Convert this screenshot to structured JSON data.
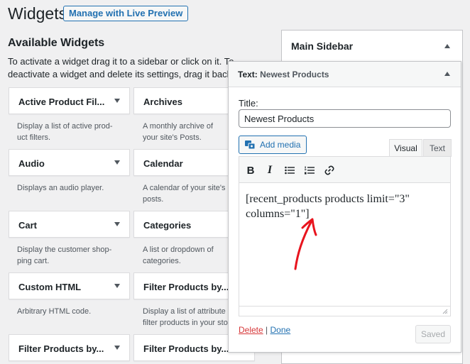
{
  "header": {
    "title": "Widgets",
    "preview_button": "Manage with Live Preview"
  },
  "available": {
    "title": "Available Widgets",
    "description": "To activate a widget drag it to a sidebar or click on it. To deactivate a widget and delete its settings, drag it back.",
    "widgets": [
      {
        "name": "Active Product Fil...",
        "desc": "Display a list of active prod-uct filters."
      },
      {
        "name": "Archives",
        "desc": "A monthly archive of your site's Posts."
      },
      {
        "name": "Audio",
        "desc": "Displays an audio player."
      },
      {
        "name": "Calendar",
        "desc": "A calendar of your site's posts."
      },
      {
        "name": "Cart",
        "desc": "Display the customer shop-ping cart."
      },
      {
        "name": "Categories",
        "desc": "A list or dropdown of categories."
      },
      {
        "name": "Custom HTML",
        "desc": "Arbitrary HTML code."
      },
      {
        "name": "Filter Products by...",
        "desc": "Display a list of attribute filter products in your sto"
      },
      {
        "name": "Filter Products by...",
        "desc": ""
      },
      {
        "name": "Filter Products by...",
        "desc": ""
      }
    ]
  },
  "sidebar": {
    "title": "Main Sidebar"
  },
  "text_widget": {
    "header_prefix": "Text:",
    "header_name": "Newest Products",
    "title_label": "Title:",
    "title_value": "Newest Products",
    "add_media": "Add media",
    "tab_visual": "Visual",
    "tab_text": "Text",
    "content": "[recent_products products limit=\"3\" columns=\"1\"]",
    "delete_label": "Delete",
    "separator": "|",
    "done_label": "Done",
    "saved_label": "Saved"
  },
  "colors": {
    "accent": "#2271b1",
    "delete": "#d63638",
    "annotation": "#e8141e"
  }
}
